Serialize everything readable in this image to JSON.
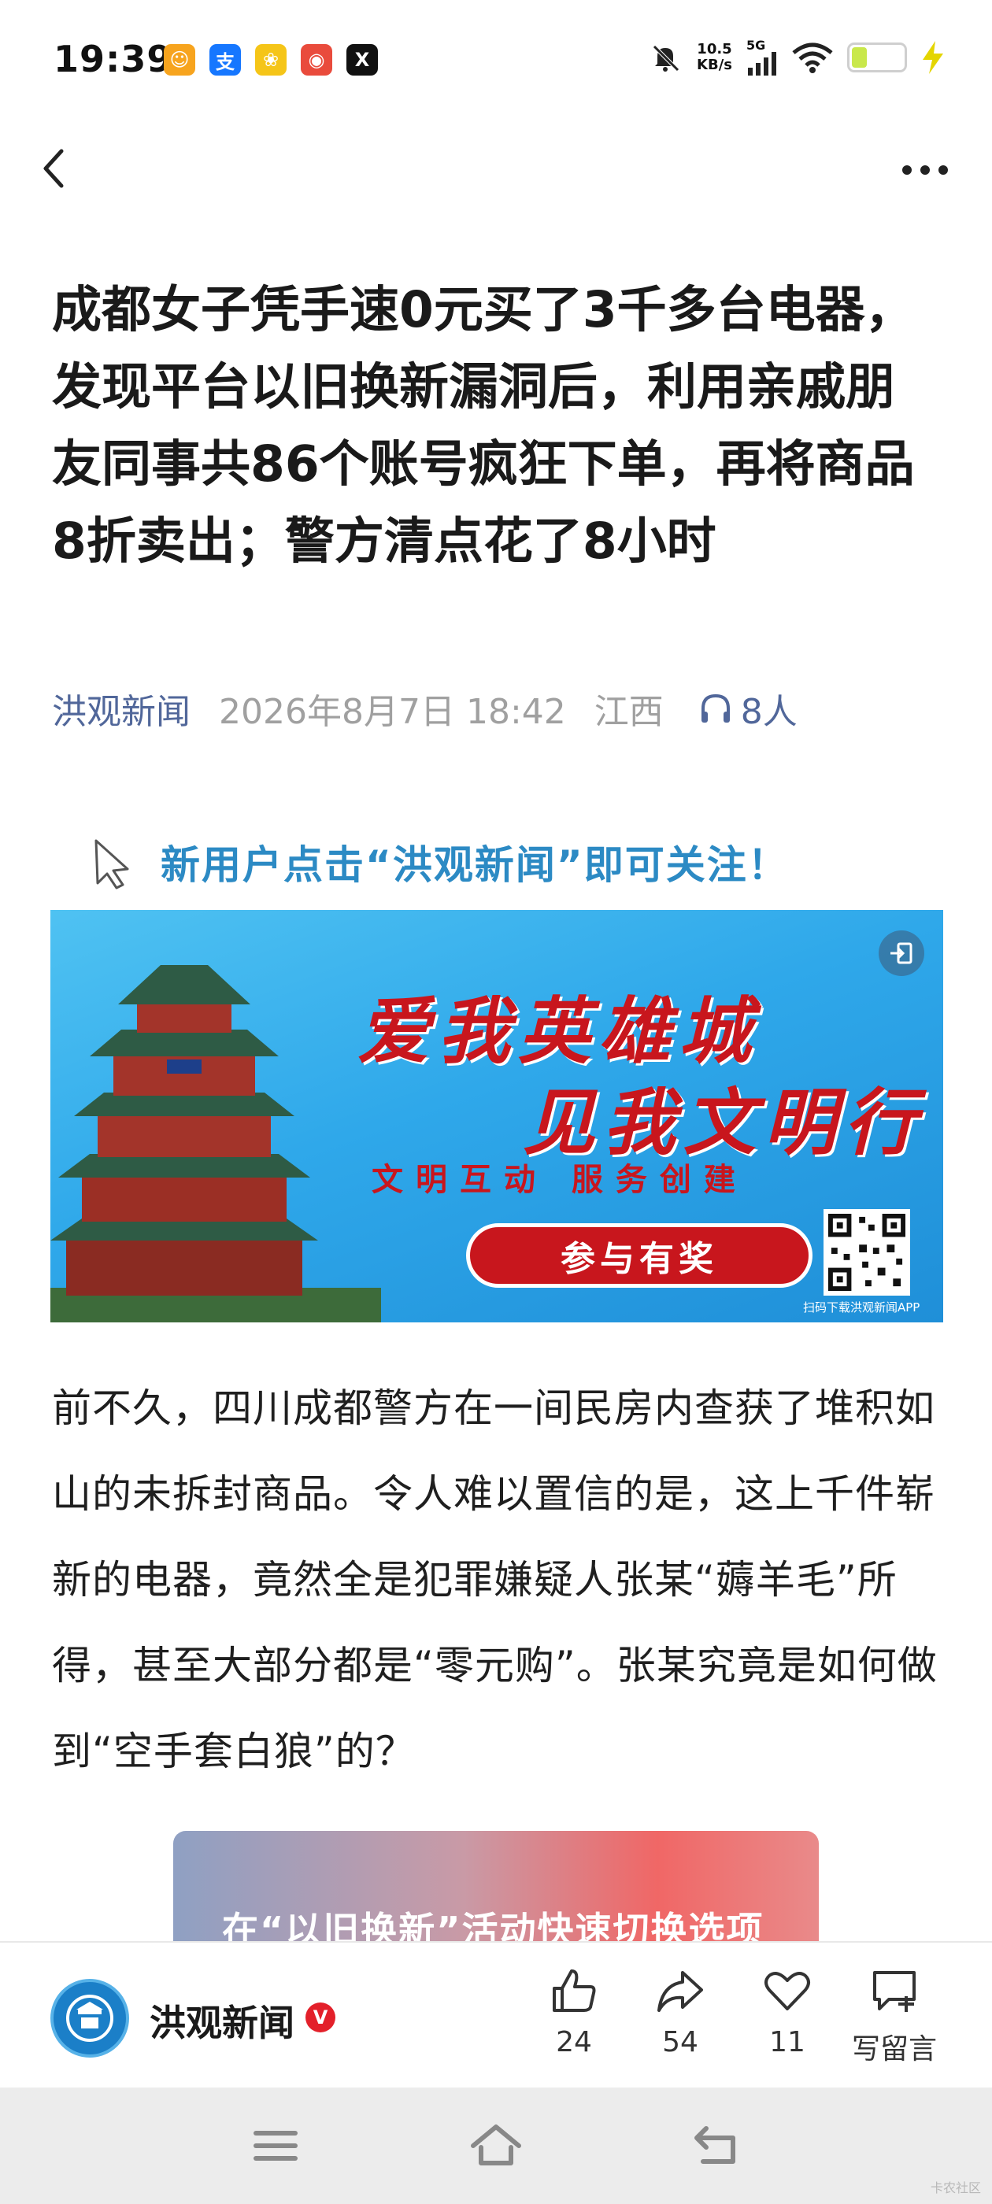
{
  "status_bar": {
    "time": "19:39",
    "app_icons": [
      {
        "name": "accessibility-app-icon",
        "glyph": "☺",
        "color": "#f7a41e"
      },
      {
        "name": "alipay-app-icon",
        "glyph": "支",
        "color": "#1677ff"
      },
      {
        "name": "cartoon-app-icon",
        "glyph": "❀",
        "color": "#f5c518"
      },
      {
        "name": "maps-app-icon",
        "glyph": "◉",
        "color": "#e94b3c"
      },
      {
        "name": "x-app-icon",
        "glyph": "X",
        "color": "#111111"
      }
    ],
    "net_speed_value": "10.5",
    "net_speed_unit": "KB/s",
    "network": "5G",
    "battery_level": 0.3,
    "battery_color": "#c9e84b"
  },
  "article": {
    "title": "成都女子凭手速0元买了3千多台电器，发现平台以旧换新漏洞后，利用亲戚朋友同事共86个账号疯狂下单，再将商品8折卖出；警方清点花了8小时",
    "source": "洪观新闻",
    "date": "2026年8月7日 18:42",
    "region": "江西",
    "listeners": "8人",
    "follow_hint": "新用户点击“洪观新闻”即可关注！",
    "banner": {
      "slogan_line1": "爱我英雄城",
      "slogan_line2": "见我文明行",
      "subtitle": "文明互动  服务创建",
      "button": "参与有奖",
      "qr_caption": "扫码下载洪观新闻APP",
      "accent_color": "#c8161d"
    },
    "body": "前不久，四川成都警方在一间民房内查获了堆积如山的未拆封商品。令人难以置信的是，这上千件崭新的电器，竟然全是犯罪嫌疑人张某“薅羊毛”所得，甚至大部分都是“零元购”。张某究竟是如何做到“空手套白狼”的？",
    "inline_image_caption": "在“以旧换新”活动快速切换选项"
  },
  "action_bar": {
    "account_name": "洪观新闻",
    "verified_badge": "V",
    "like_count": "24",
    "share_count": "54",
    "favorite_count": "11",
    "comment_label": "写留言"
  },
  "watermark": "卡农社区",
  "colors": {
    "link_blue": "#51679a",
    "hint_blue": "#2c8ac4",
    "banner_blue": "#2fa8ea"
  }
}
